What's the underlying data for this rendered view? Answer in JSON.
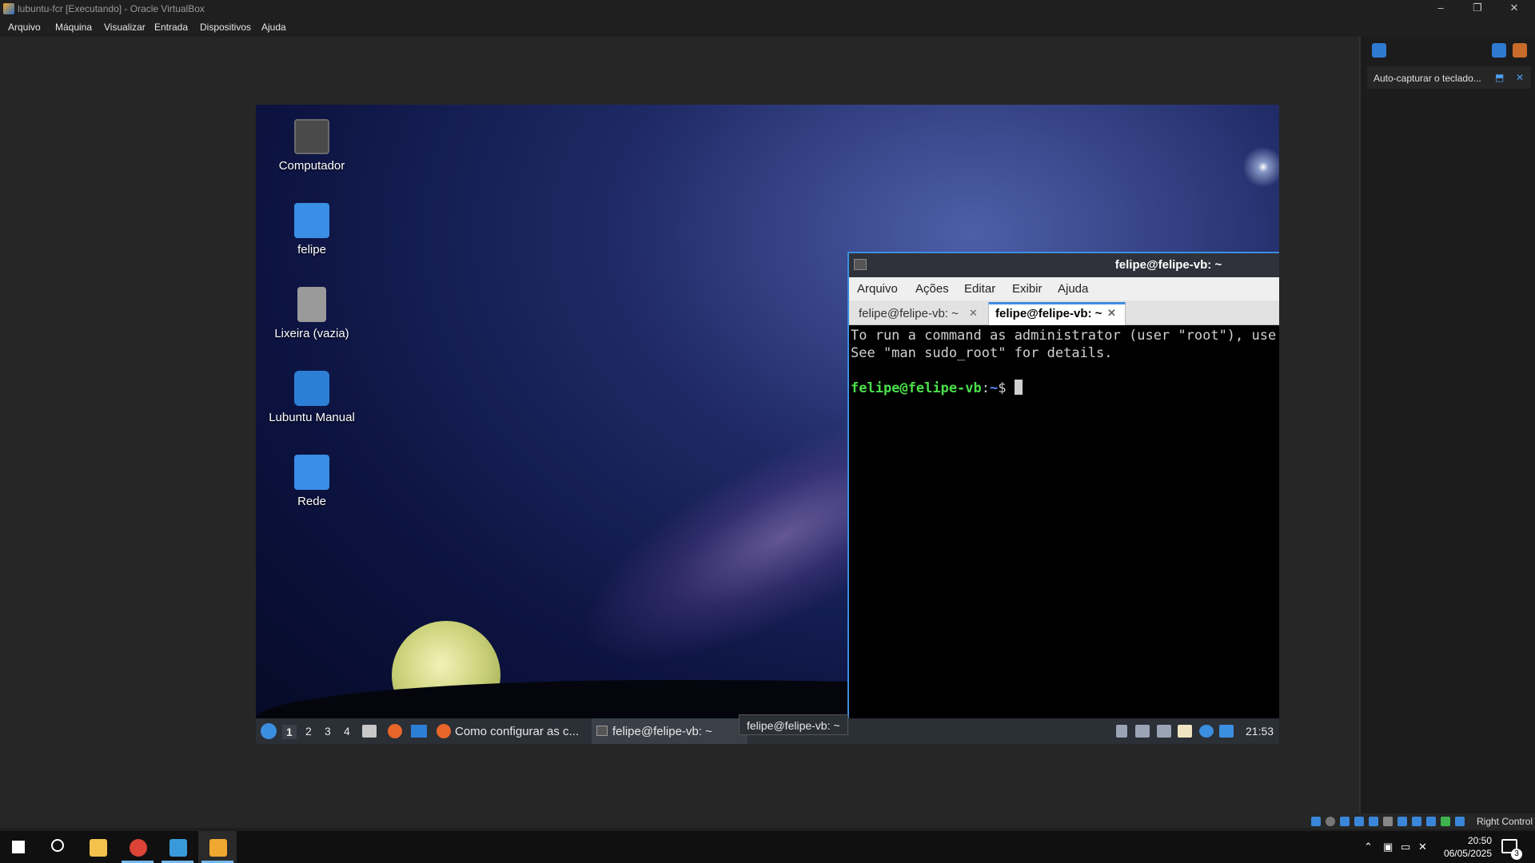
{
  "host": {
    "window_title": "lubuntu-fcr [Executando] - Oracle VirtualBox",
    "menu": [
      "Arquivo",
      "Máquina",
      "Visualizar",
      "Entrada",
      "Dispositivos",
      "Ajuda"
    ],
    "window_controls": {
      "minimize": "–",
      "restore": "❐",
      "close": "✕"
    },
    "notification": {
      "text": "Auto-capturar o teclado...",
      "pin": "⬒",
      "close": "✕"
    },
    "status_bar": {
      "host_key": "Right Control"
    }
  },
  "guest": {
    "desktop_icons": [
      {
        "label": "Computador",
        "icon": "computer-icon",
        "color": "#555555"
      },
      {
        "label": "felipe",
        "icon": "home-folder-icon",
        "color": "#3a8ee6"
      },
      {
        "label": "Lixeira (vazia)",
        "icon": "trash-icon",
        "color": "#9a9a9a"
      },
      {
        "label": "Lubuntu Manual",
        "icon": "manual-icon",
        "color": "#2d7fd6"
      },
      {
        "label": "Rede",
        "icon": "network-folder-icon",
        "color": "#3a8ee6"
      }
    ],
    "terminal": {
      "title": "felipe@felipe-vb: ~",
      "title_controls": {
        "minimize": "–",
        "maximize": "⤢",
        "close": "✕"
      },
      "menu": [
        "Arquivo",
        "Ações",
        "Editar",
        "Exibir",
        "Ajuda"
      ],
      "tabs": [
        {
          "label": "felipe@felipe-vb: ~",
          "active": false,
          "close": "✕"
        },
        {
          "label": "felipe@felipe-vb: ~",
          "active": true,
          "close": "✕"
        }
      ],
      "lines": [
        "To run a command as administrator (user \"root\"), use \"sudo <command>\".",
        "See \"man sudo_root\" for details."
      ],
      "prompt_user": "felipe@felipe-vb",
      "prompt_sep": ":",
      "prompt_path": "~",
      "prompt_symbol": "$"
    },
    "panel": {
      "workspaces": [
        "1",
        "2",
        "3",
        "4"
      ],
      "tasks": [
        {
          "label": "Como configurar as c...",
          "icon": "firefox-icon"
        },
        {
          "label": "felipe@felipe-vb: ~",
          "icon": "terminal-icon"
        }
      ],
      "tooltip": "felipe@felipe-vb: ~",
      "clock": "21:53"
    }
  },
  "windows": {
    "clock_time": "20:50",
    "clock_date": "06/05/2025",
    "notification_count": "3",
    "apps": [
      {
        "name": "file-explorer-icon",
        "color": "#f2c14e"
      },
      {
        "name": "chrome-icon",
        "color": "#db4437"
      },
      {
        "name": "vscode-icon",
        "color": "#3a9ad9"
      },
      {
        "name": "virtualbox-icon",
        "color": "#f0a830"
      }
    ]
  }
}
